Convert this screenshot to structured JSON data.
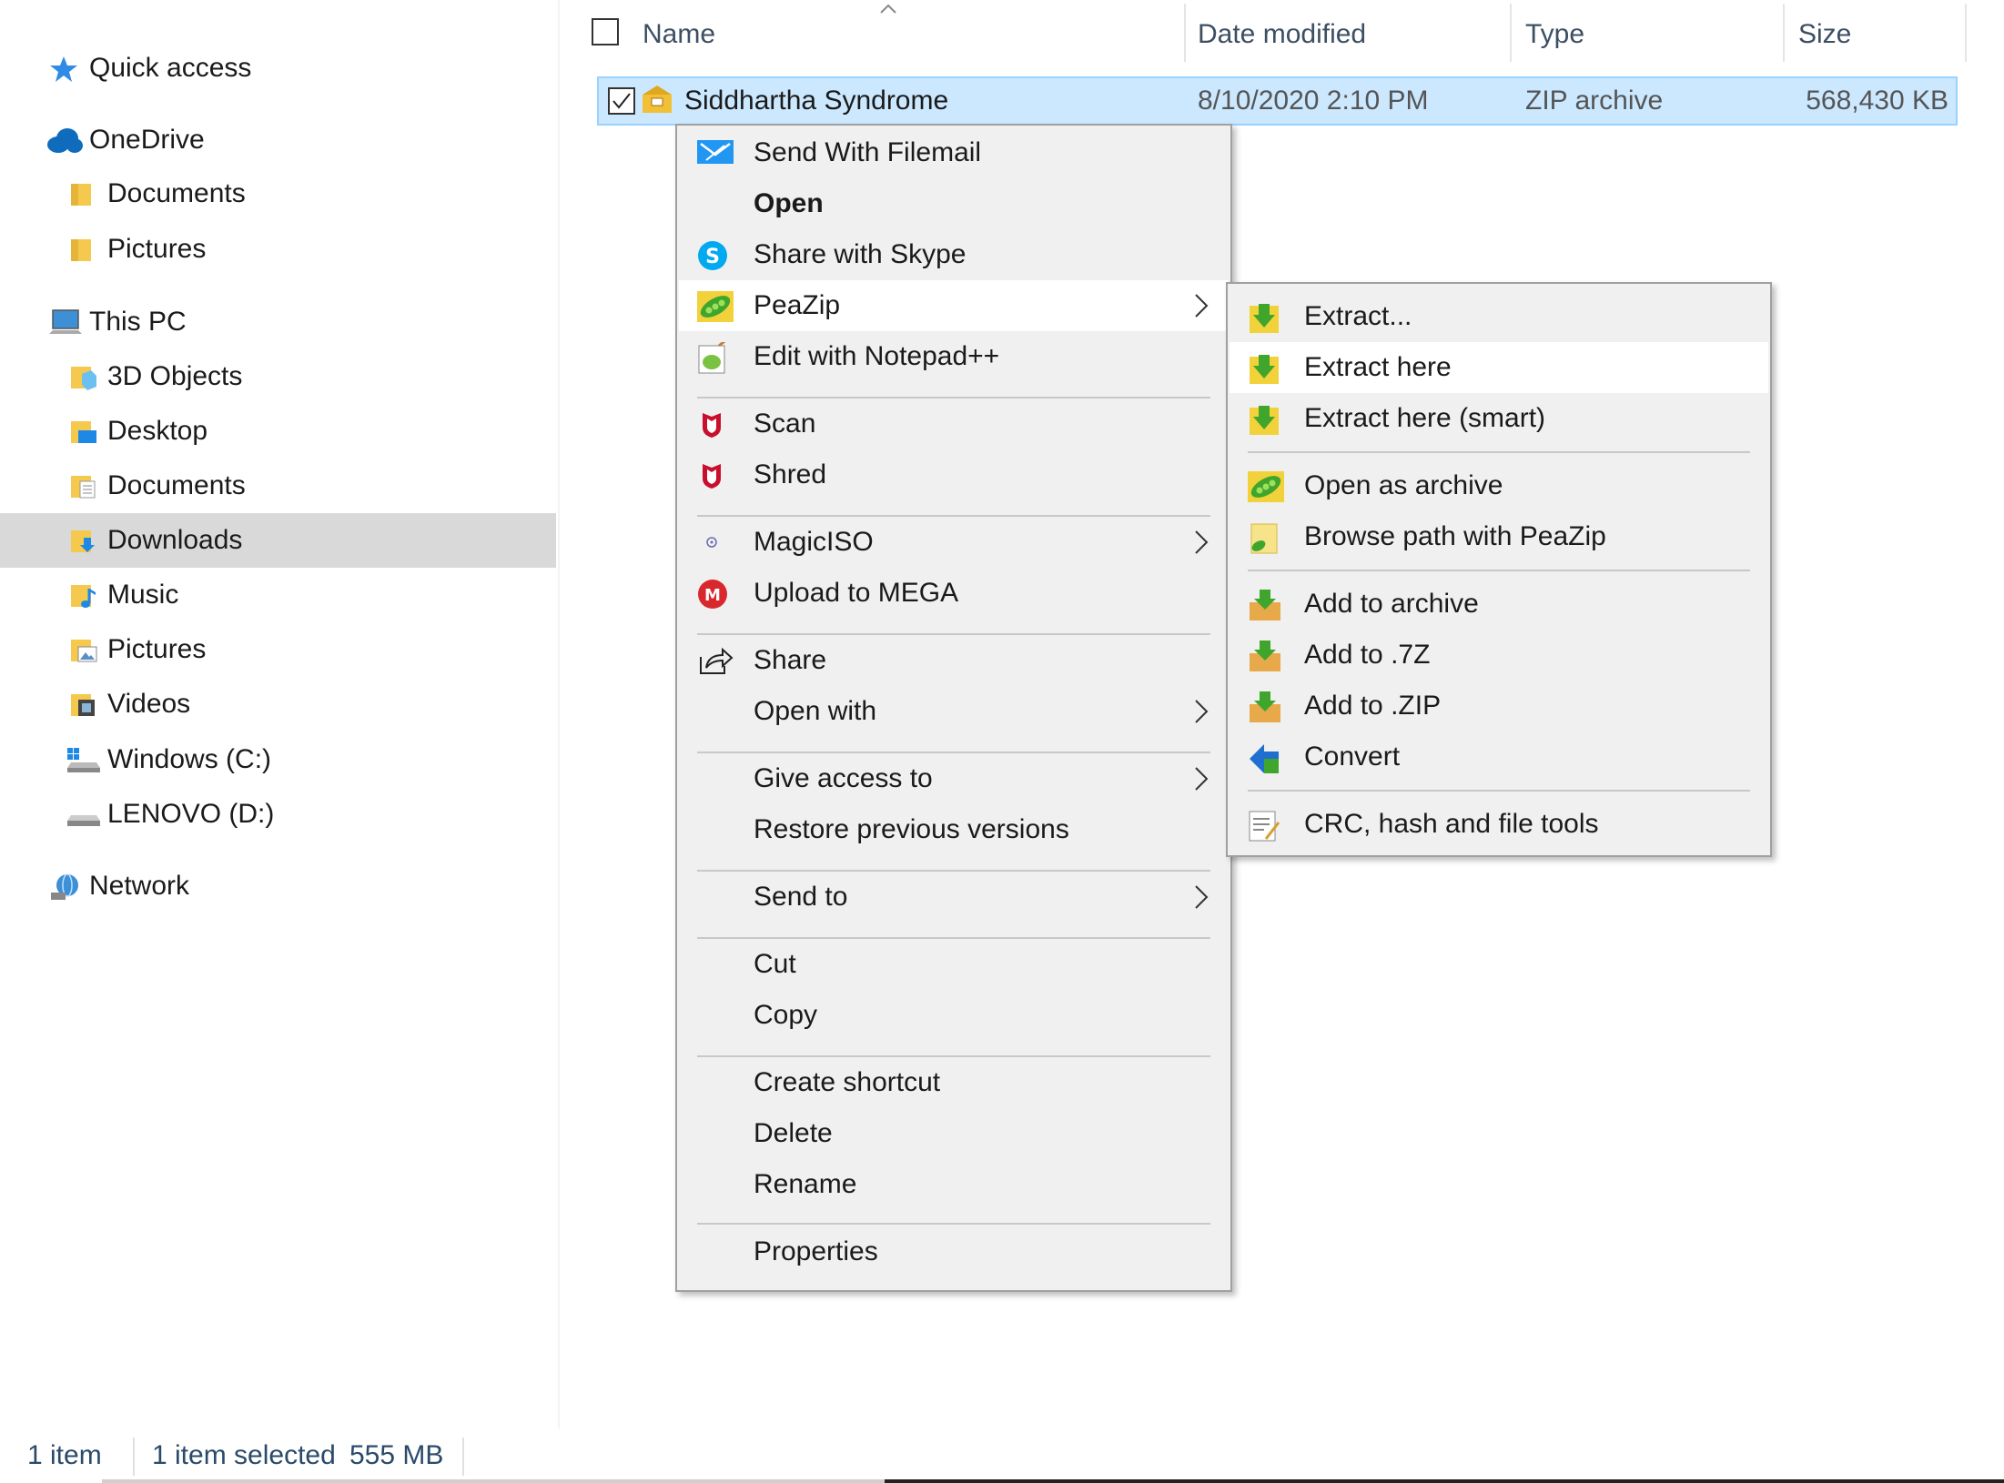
{
  "nav": {
    "items": [
      {
        "label": "Quick access",
        "icon": "star-icon"
      },
      {
        "label": "OneDrive",
        "icon": "cloud-icon"
      },
      {
        "label": "Documents",
        "icon": "folder-icon"
      },
      {
        "label": "Pictures",
        "icon": "folder-icon"
      },
      {
        "label": "This PC",
        "icon": "computer-icon"
      },
      {
        "label": "3D Objects",
        "icon": "3d-objects-folder-icon"
      },
      {
        "label": "Desktop",
        "icon": "desktop-folder-icon"
      },
      {
        "label": "Documents",
        "icon": "documents-folder-icon"
      },
      {
        "label": "Downloads",
        "icon": "downloads-folder-icon"
      },
      {
        "label": "Music",
        "icon": "music-folder-icon"
      },
      {
        "label": "Pictures",
        "icon": "pictures-folder-icon"
      },
      {
        "label": "Videos",
        "icon": "videos-folder-icon"
      },
      {
        "label": "Windows (C:)",
        "icon": "windows-drive-icon"
      },
      {
        "label": "LENOVO (D:)",
        "icon": "drive-icon"
      },
      {
        "label": "Network",
        "icon": "network-icon"
      }
    ],
    "selected": "Downloads"
  },
  "columns": {
    "name": "Name",
    "date": "Date modified",
    "type": "Type",
    "size": "Size"
  },
  "file": {
    "name": "Siddhartha Syndrome",
    "date": "8/10/2020 2:10 PM",
    "type": "ZIP archive",
    "size": "568,430 KB",
    "checked": true
  },
  "context_menu": {
    "items": [
      {
        "label": "Send With Filemail",
        "icon": "filemail-icon"
      },
      {
        "label": "Open",
        "bold": true
      },
      {
        "label": "Share with Skype",
        "icon": "skype-icon"
      },
      {
        "label": "PeaZip",
        "icon": "peazip-icon",
        "submenu": true,
        "highlighted": true
      },
      {
        "label": "Edit with Notepad++",
        "icon": "notepadpp-icon"
      },
      {
        "label": "Scan",
        "icon": "mcafee-icon"
      },
      {
        "label": "Shred",
        "icon": "mcafee-icon"
      },
      {
        "label": "MagicISO",
        "icon": "magiciso-icon",
        "submenu": true
      },
      {
        "label": "Upload to MEGA",
        "icon": "mega-icon"
      },
      {
        "label": "Share",
        "icon": "share-icon"
      },
      {
        "label": "Open with",
        "submenu": true
      },
      {
        "label": "Give access to",
        "submenu": true
      },
      {
        "label": "Restore previous versions"
      },
      {
        "label": "Send to",
        "submenu": true
      },
      {
        "label": "Cut"
      },
      {
        "label": "Copy"
      },
      {
        "label": "Create shortcut"
      },
      {
        "label": "Delete"
      },
      {
        "label": "Rename"
      },
      {
        "label": "Properties"
      }
    ]
  },
  "peazip_submenu": {
    "items": [
      {
        "label": "Extract...",
        "icon": "extract-icon"
      },
      {
        "label": "Extract here",
        "icon": "extract-icon",
        "highlighted": true
      },
      {
        "label": "Extract here (smart)",
        "icon": "extract-icon"
      },
      {
        "label": "Open as archive",
        "icon": "peazip-icon"
      },
      {
        "label": "Browse path with PeaZip",
        "icon": "peazip-folder-icon"
      },
      {
        "label": "Add to archive",
        "icon": "add-archive-icon"
      },
      {
        "label": "Add to .7Z",
        "icon": "add-archive-icon"
      },
      {
        "label": "Add to .ZIP",
        "icon": "add-archive-icon"
      },
      {
        "label": "Convert",
        "icon": "convert-icon"
      },
      {
        "label": "CRC, hash and file tools",
        "icon": "crc-tools-icon"
      }
    ]
  },
  "status": {
    "count": "1 item",
    "selection": "1 item selected",
    "size": "555 MB"
  },
  "colors": {
    "selection_bg": "#cce8ff",
    "selection_border": "#99d1ff",
    "nav_selected": "#d9d9d9",
    "menu_bg": "#f0f0f0",
    "menu_highlight": "#ffffff"
  }
}
